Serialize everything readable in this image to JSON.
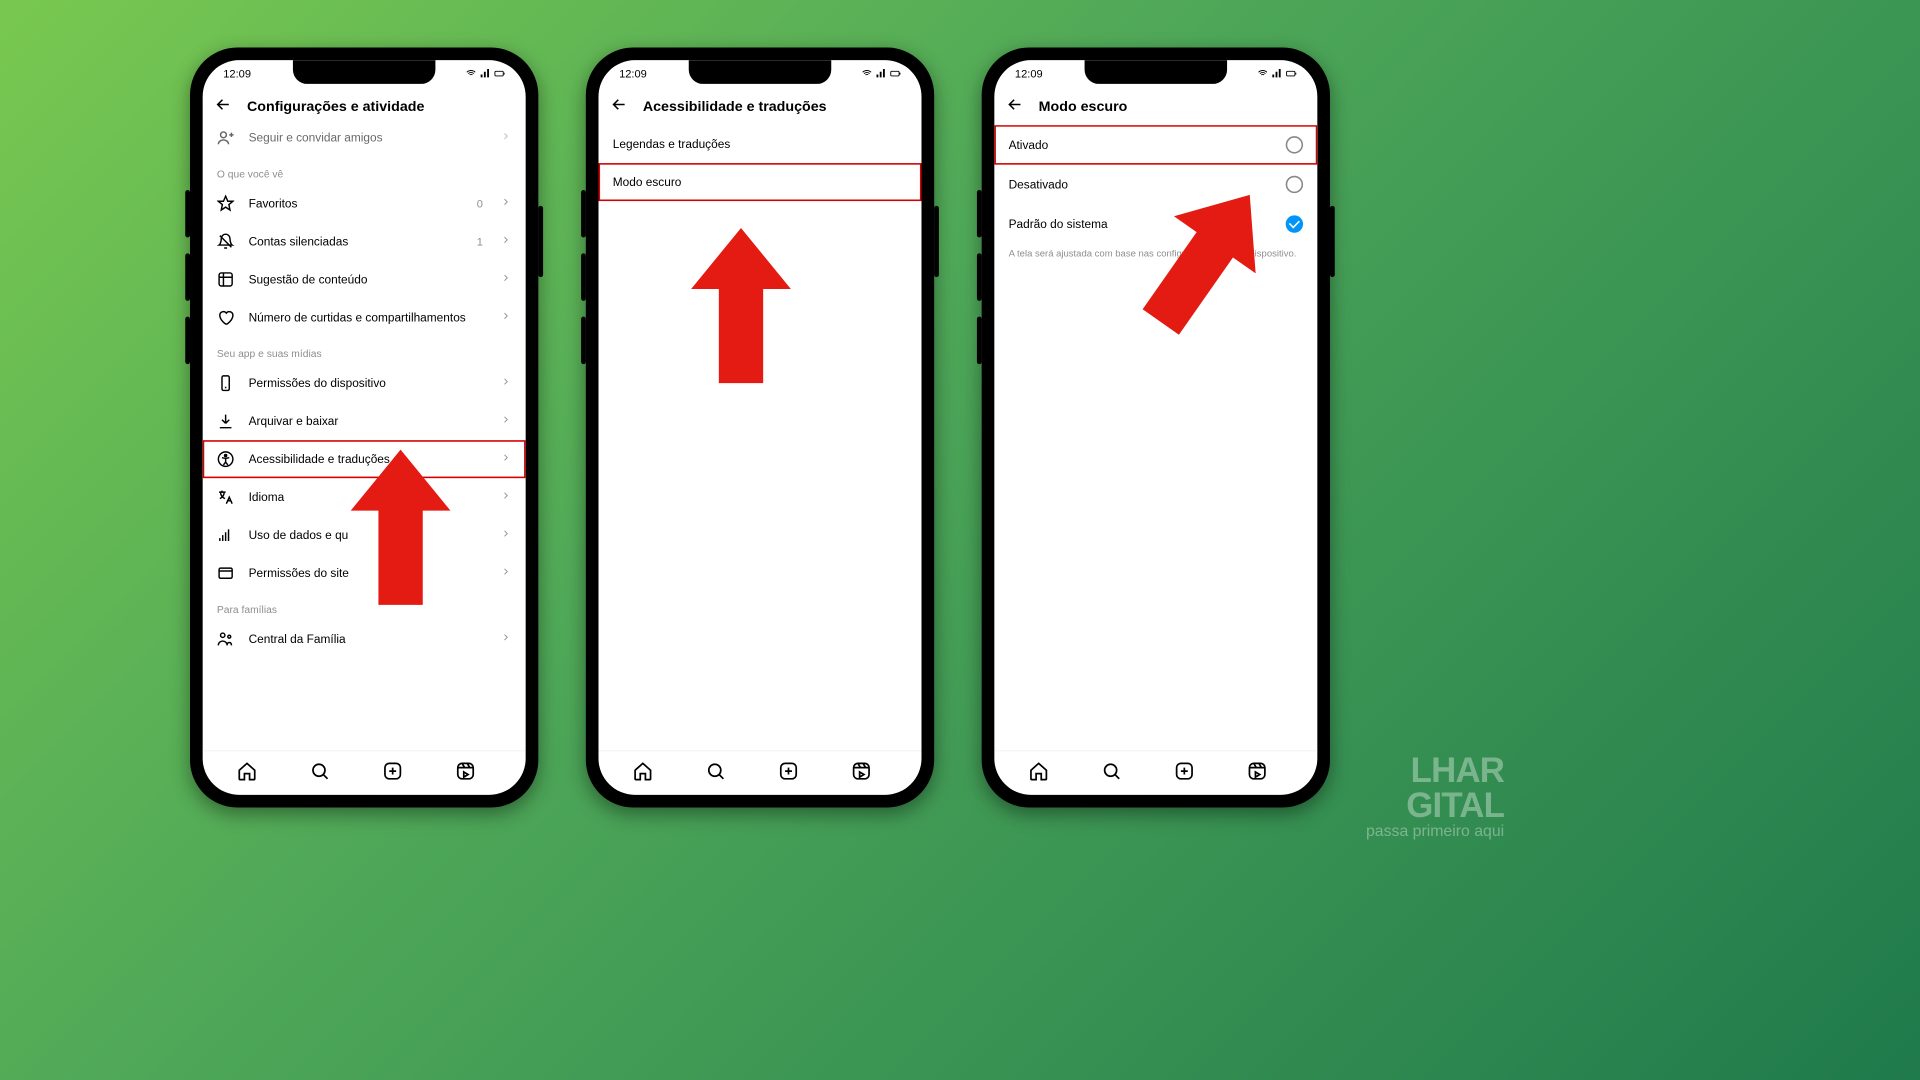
{
  "status": {
    "time": "12:09"
  },
  "watermark": {
    "line1": "LHAR",
    "line2": "GITAL",
    "tag": "passa primeiro aqui"
  },
  "phone1": {
    "title": "Configurações e atividade",
    "top_row": "Seguir e convidar amigos",
    "sections": {
      "s1": {
        "title": "O que você vê",
        "favoritos": {
          "label": "Favoritos",
          "count": "0"
        },
        "contas_sil": {
          "label": "Contas silenciadas",
          "count": "1"
        },
        "sugestao": "Sugestão de conteúdo",
        "curtidas": "Número de curtidas e compartilhamentos"
      },
      "s2": {
        "title": "Seu app e suas mídias",
        "permissoes": "Permissões do dispositivo",
        "arquivar": "Arquivar e baixar",
        "acessibilidade": "Acessibilidade e traduções",
        "idioma": "Idioma",
        "uso_dados": "Uso de dados e qu",
        "perm_site": "Permissões do site"
      },
      "s3": {
        "title": "Para famílias",
        "central": "Central da Família"
      }
    }
  },
  "phone2": {
    "title": "Acessibilidade e traduções",
    "legendas": "Legendas e traduções",
    "modo_escuro": "Modo escuro"
  },
  "phone3": {
    "title": "Modo escuro",
    "ativado": "Ativado",
    "desativado": "Desativado",
    "padrao": "Padrão do sistema",
    "hint": "A tela será ajustada com base nas configurações do seu dispositivo."
  }
}
